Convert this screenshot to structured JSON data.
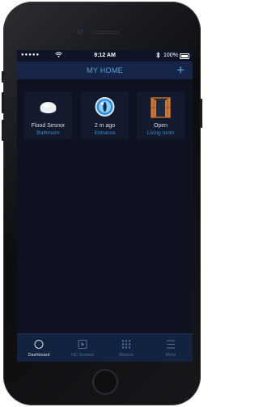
{
  "status_bar": {
    "signal": "●●●●●",
    "time": "9:12 AM",
    "battery": "100%"
  },
  "header": {
    "title": "MY HOME",
    "add_icon": "plus-icon",
    "accent_color": "#5ba4dc"
  },
  "devices": [
    {
      "name": "Flood Sesnor",
      "room": "Bathroom",
      "icon": "flood-sensor-icon"
    },
    {
      "name": "2 m ago",
      "room": "Entrance",
      "icon": "motion-eye-sensor-icon"
    },
    {
      "name": "Open",
      "room": "Living room",
      "icon": "window-open-icon"
    }
  ],
  "tabs": [
    {
      "label": "Dashboard",
      "icon": "circle-icon",
      "active": true
    },
    {
      "label": "HC Scenes",
      "icon": "play-square-icon",
      "active": false
    },
    {
      "label": "Rooms",
      "icon": "grid-dots-icon",
      "active": false
    },
    {
      "label": "More",
      "icon": "menu-lines-icon",
      "active": false
    }
  ],
  "colors": {
    "background": "#0d1120",
    "tile": "#141a2e",
    "room_text": "#2f8fd8",
    "tabbar": "#12233f"
  }
}
